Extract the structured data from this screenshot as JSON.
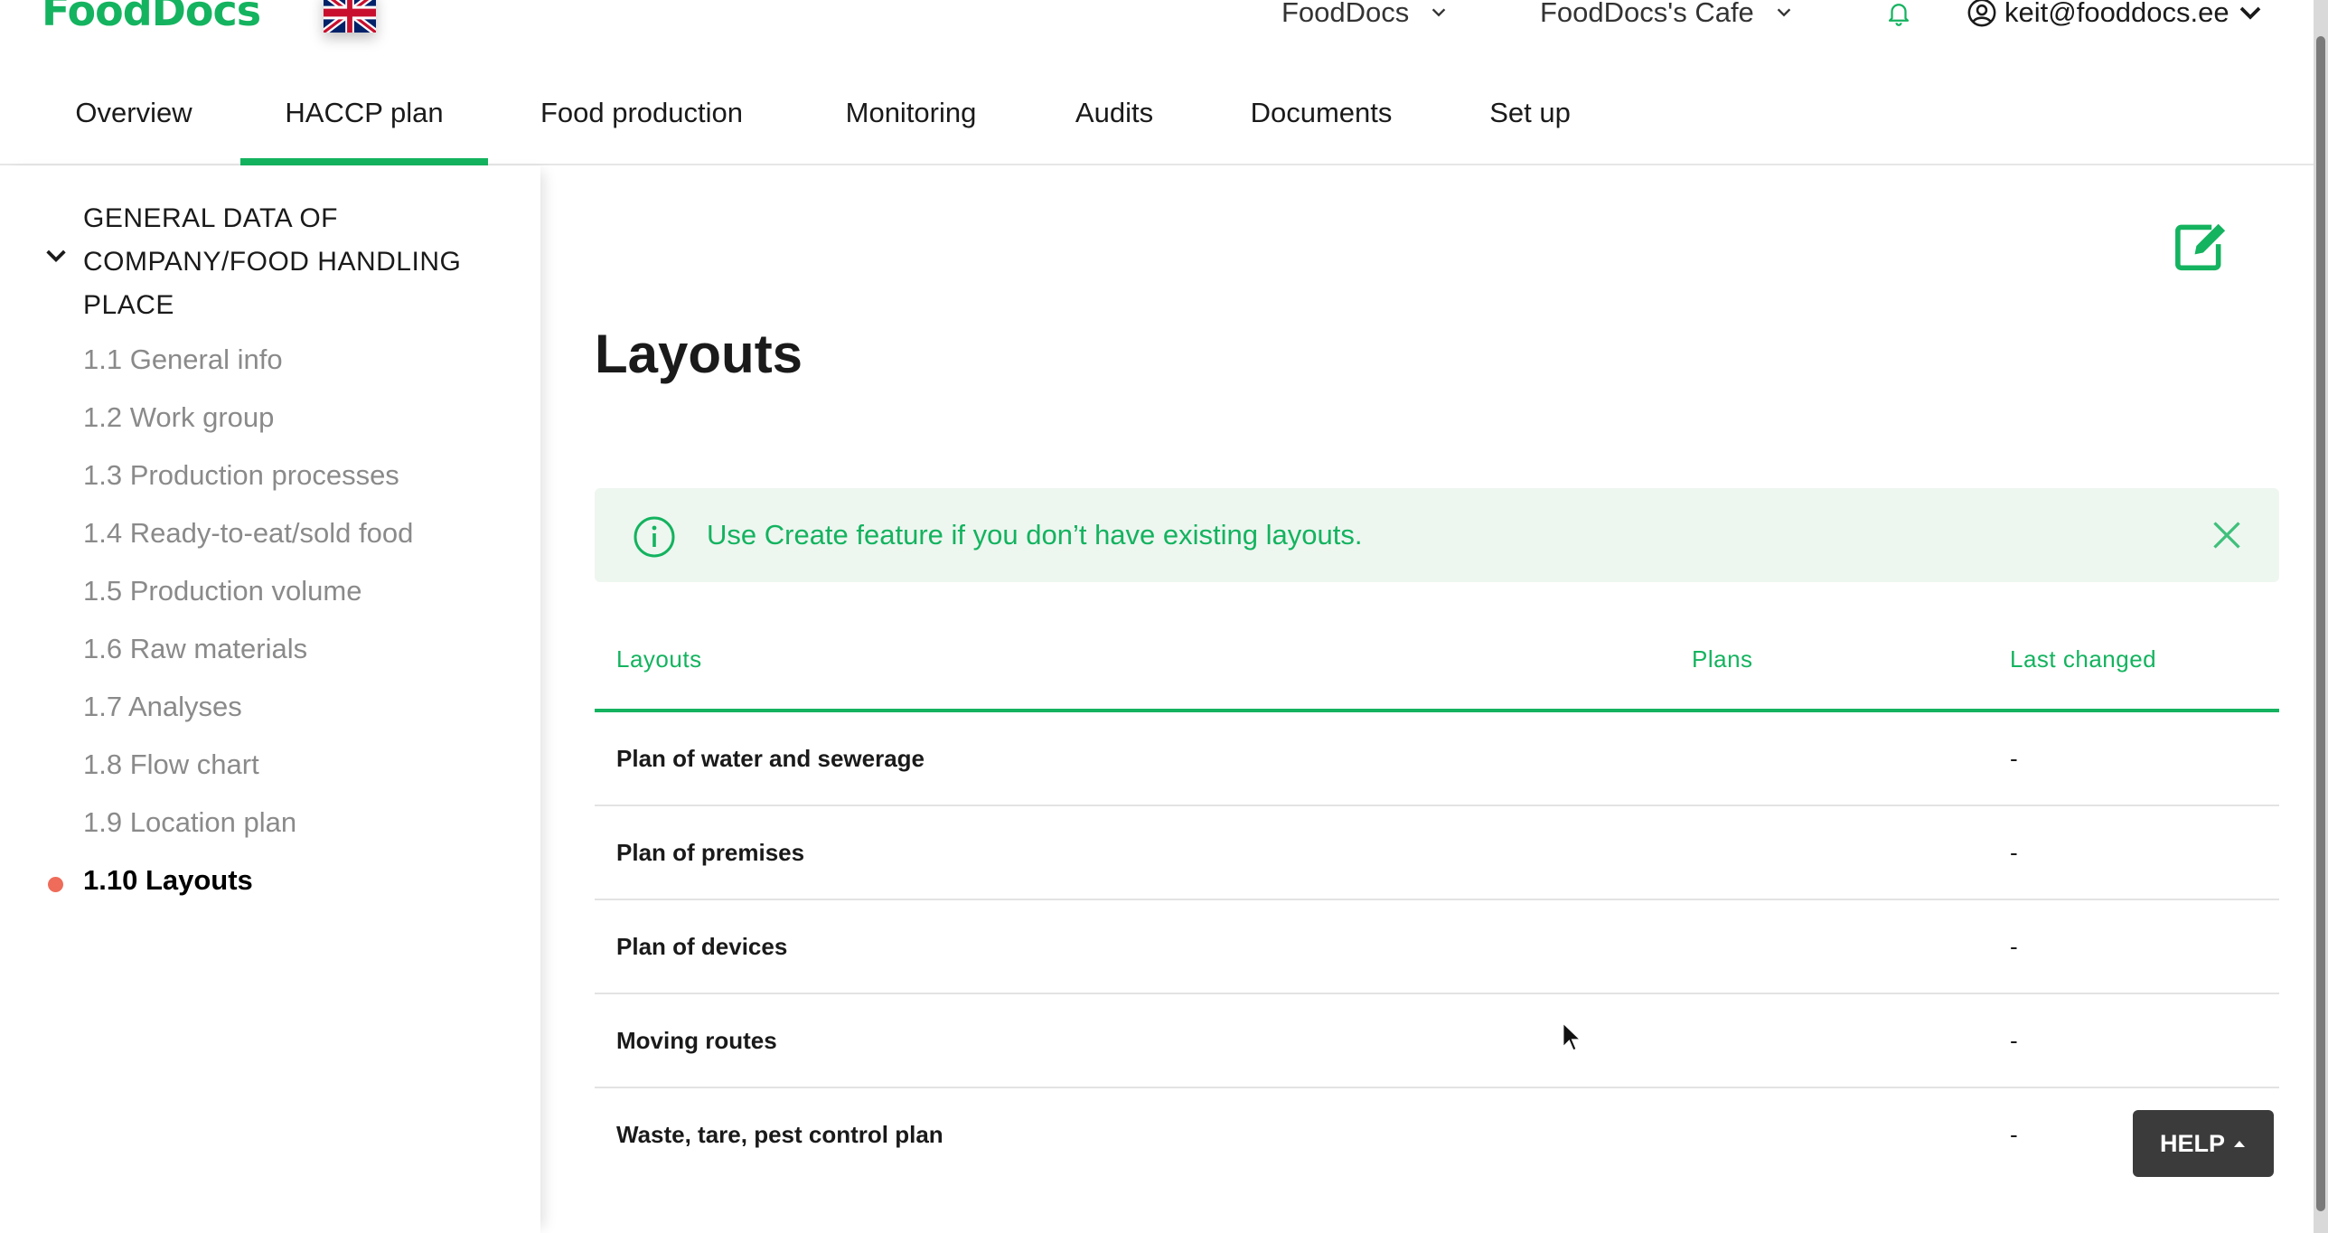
{
  "header": {
    "logo": "FoodDocs",
    "company_dropdown": "FoodDocs",
    "location_dropdown": "FoodDocs's Cafe",
    "user_email": "keit@fooddocs.ee"
  },
  "nav": {
    "tabs": [
      {
        "label": "Overview"
      },
      {
        "label": "HACCP plan"
      },
      {
        "label": "Food production"
      },
      {
        "label": "Monitoring"
      },
      {
        "label": "Audits"
      },
      {
        "label": "Documents"
      },
      {
        "label": "Set up"
      }
    ],
    "active_tab": "HACCP plan"
  },
  "sidebar": {
    "section_title_lines": [
      "GENERAL DATA OF",
      "COMPANY/FOOD HANDLING",
      "PLACE"
    ],
    "items": [
      {
        "label": "1.1 General info"
      },
      {
        "label": "1.2 Work group"
      },
      {
        "label": "1.3 Production processes"
      },
      {
        "label": "1.4 Ready-to-eat/sold food"
      },
      {
        "label": "1.5 Production volume"
      },
      {
        "label": "1.6 Raw materials"
      },
      {
        "label": "1.7 Analyses"
      },
      {
        "label": "1.8 Flow chart"
      },
      {
        "label": "1.9 Location plan"
      },
      {
        "label": "1.10 Layouts"
      }
    ],
    "current_item": "1.10 Layouts"
  },
  "main": {
    "title": "Layouts",
    "info_message": "Use Create feature if you don’t have existing layouts.",
    "table": {
      "headers": {
        "layouts": "Layouts",
        "plans": "Plans",
        "last_changed": "Last changed"
      },
      "rows": [
        {
          "name": "Plan of water and sewerage",
          "last_changed": "-"
        },
        {
          "name": "Plan of premises",
          "last_changed": "-"
        },
        {
          "name": "Plan of devices",
          "last_changed": "-"
        },
        {
          "name": "Moving routes",
          "last_changed": "-"
        },
        {
          "name": "Waste, tare, pest control plan",
          "last_changed": "-"
        }
      ]
    }
  },
  "help_button": {
    "label": "HELP"
  },
  "colors": {
    "accent": "#14b35f",
    "info_bg": "#eef6f0",
    "current_dot": "#ef6c5a",
    "help_bg": "#3b3b3b"
  }
}
